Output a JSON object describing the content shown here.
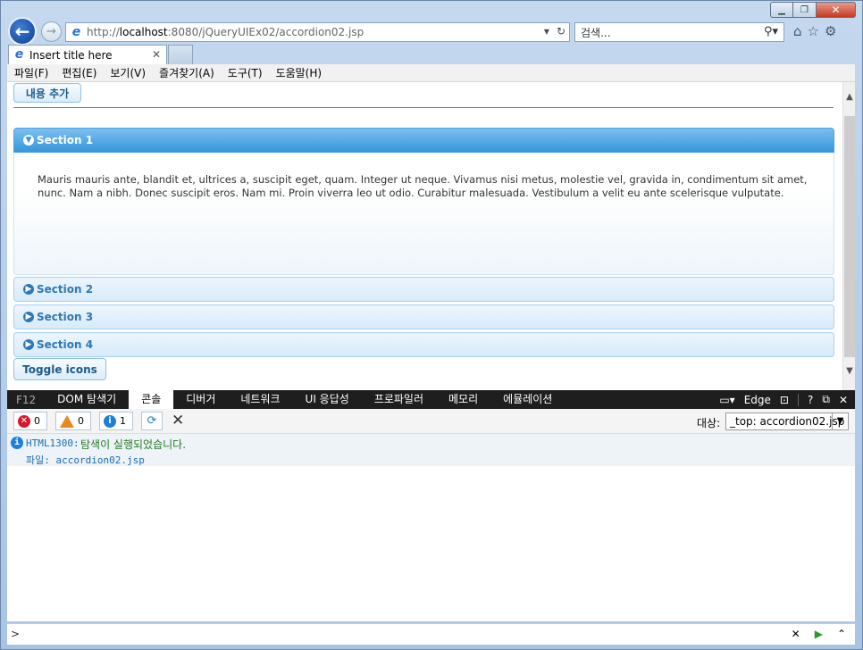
{
  "browser": {
    "address": {
      "prefix": "http://",
      "host": "localhost",
      "rest": ":8080/jQueryUIEx02/accordion02.jsp"
    },
    "search_placeholder": "검색...",
    "tab_title": "Insert title here",
    "menu": [
      "파일(F)",
      "편집(E)",
      "보기(V)",
      "즐겨찾기(A)",
      "도구(T)",
      "도움말(H)"
    ]
  },
  "page": {
    "add_button": "내용 추가",
    "toggle_button": "Toggle icons",
    "sections": [
      {
        "title": "Section 1",
        "active": true
      },
      {
        "title": "Section 2",
        "active": false
      },
      {
        "title": "Section 3",
        "active": false
      },
      {
        "title": "Section 4",
        "active": false
      }
    ],
    "section1_content": "Mauris mauris ante, blandit et, ultrices a, suscipit eget, quam. Integer ut neque. Vivamus nisi metus, molestie vel, gravida in, condimentum sit amet, nunc. Nam a nibh. Donec suscipit eros. Nam mi. Proin viverra leo ut odio. Curabitur malesuada. Vestibulum a velit eu ante scelerisque vulputate."
  },
  "devtools": {
    "f12": "F12",
    "tabs": [
      "DOM 탐색기",
      "콘솔",
      "디버거",
      "네트워크",
      "UI 응답성",
      "프로파일러",
      "메모리",
      "에뮬레이션"
    ],
    "active_tab": "콘솔",
    "mode": "Edge",
    "help": "?",
    "counts": {
      "errors": "0",
      "warnings": "0",
      "messages": "1"
    },
    "target_label": "대상:",
    "target_value": "_top: accordion02.jsp",
    "message": {
      "code": "HTML1300:",
      "text": "탐색이 실행되었습니다.",
      "file": "파일: accordion02.jsp"
    },
    "prompt": ">"
  },
  "colors": {
    "accent": "#3596dc",
    "header_text": "#2e78b5",
    "error": "#d6182b",
    "warning": "#e8881d",
    "info": "#1c7fd8"
  }
}
